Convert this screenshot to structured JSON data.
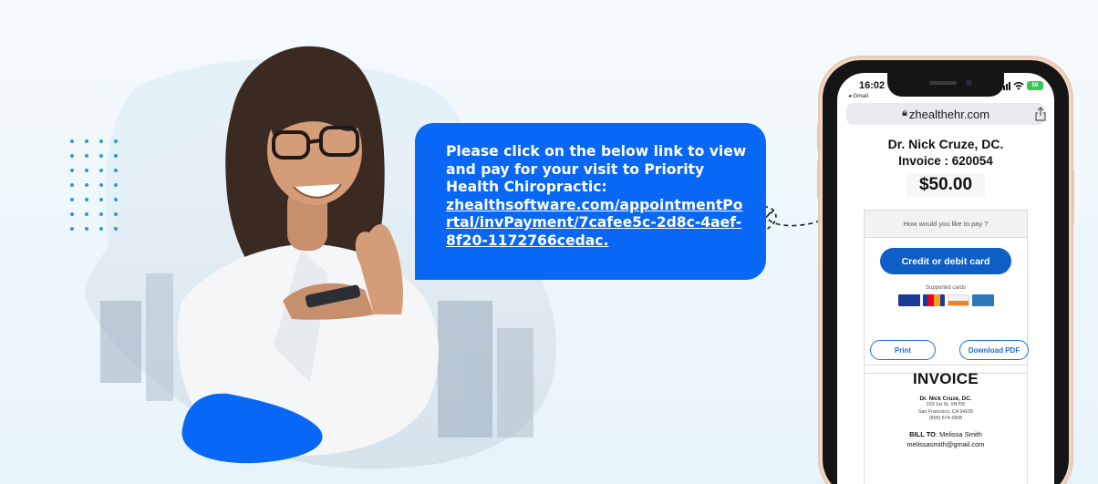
{
  "bubble": {
    "message": "Please click on the below link to view and pay for your visit to Priority Health Chiropractic:",
    "link": "zhealthsoftware.com/appointmentPortal/invPayment/7cafee5c-2d8c-4aef-8f20-1172766cedac."
  },
  "phone": {
    "status": {
      "time": "16:02",
      "back_label": "◂ Gmail",
      "battery": "50"
    },
    "url": "zhealthehr.com",
    "provider_name": "Dr. Nick Cruze, DC.",
    "invoice_label": "Invoice : 620054",
    "amount": "$50.00",
    "pay_question": "How would you like to pay ?",
    "card_button": "Credit or debit card",
    "supported_label": "Supported cards",
    "cards": [
      "visa-icon",
      "mastercard-icon",
      "discover-icon",
      "amex-icon"
    ],
    "print_button": "Print",
    "download_button": "Download PDF",
    "invoice_doc": {
      "title": "INVOICE",
      "name": "Dr. Nick Cruze, DC.",
      "address_lines": [
        "333 1st St, #N705",
        "San Francisco, CA 94105",
        "(800) 674-2908"
      ],
      "bill_to_label": "BILL TO",
      "bill_to_name": ": Melissa Smith",
      "bill_to_email": "melissasmith@gmail.com"
    }
  },
  "colors": {
    "accent": "#0867f5",
    "button_blue": "#0d5fc6",
    "dots": "#2d9ad8",
    "phone_frame": "#151515",
    "phone_rim": "#f2d5c4"
  }
}
